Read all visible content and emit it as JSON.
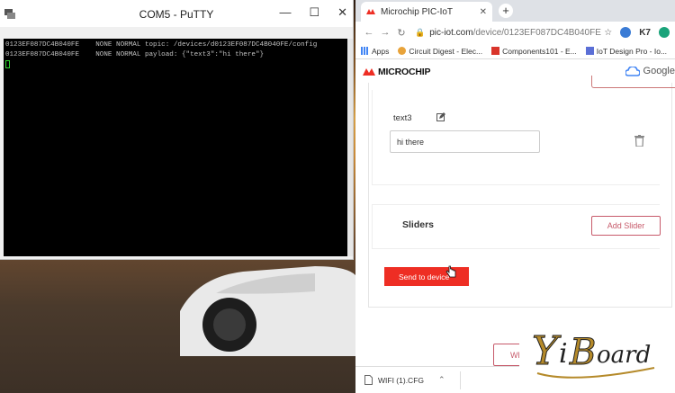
{
  "putty": {
    "title": "COM5 - PuTTY",
    "window_controls": [
      "—",
      "☐",
      "✕"
    ],
    "lines": [
      "0123EF087DC4B040FE    NONE NORMAL topic: /devices/d0123EF087DC4B040FE/config",
      "0123EF087DC4B040FE    NONE NORMAL payload: {\"text3\":\"hi there\"}"
    ]
  },
  "chrome": {
    "tab_title": "Microchip PIC-IoT",
    "tab_close": "✕",
    "new_tab": "+",
    "url_host": "pic-iot.com",
    "url_path": "/device/0123EF087DC4B040FE",
    "bookmarks": [
      "Apps",
      "Circuit Digest - Elec...",
      "Components101 - E...",
      "IoT Design Pro - Io..."
    ],
    "ext_label": "K7",
    "site": {
      "logo_text": "MICROCHIP",
      "google_text": "Google"
    },
    "text_field": {
      "label": "text3",
      "value": "hi there"
    },
    "sliders": {
      "title": "Sliders",
      "add_button": "Add Slider"
    },
    "send_button": "Send to device",
    "bottom_button": "Wh",
    "download": {
      "file_name": "WIFI (1).CFG"
    },
    "colors": {
      "accent": "#ee2e24",
      "outline_button": "#c75a6a"
    }
  },
  "watermark": {
    "text": "YiBoard"
  }
}
